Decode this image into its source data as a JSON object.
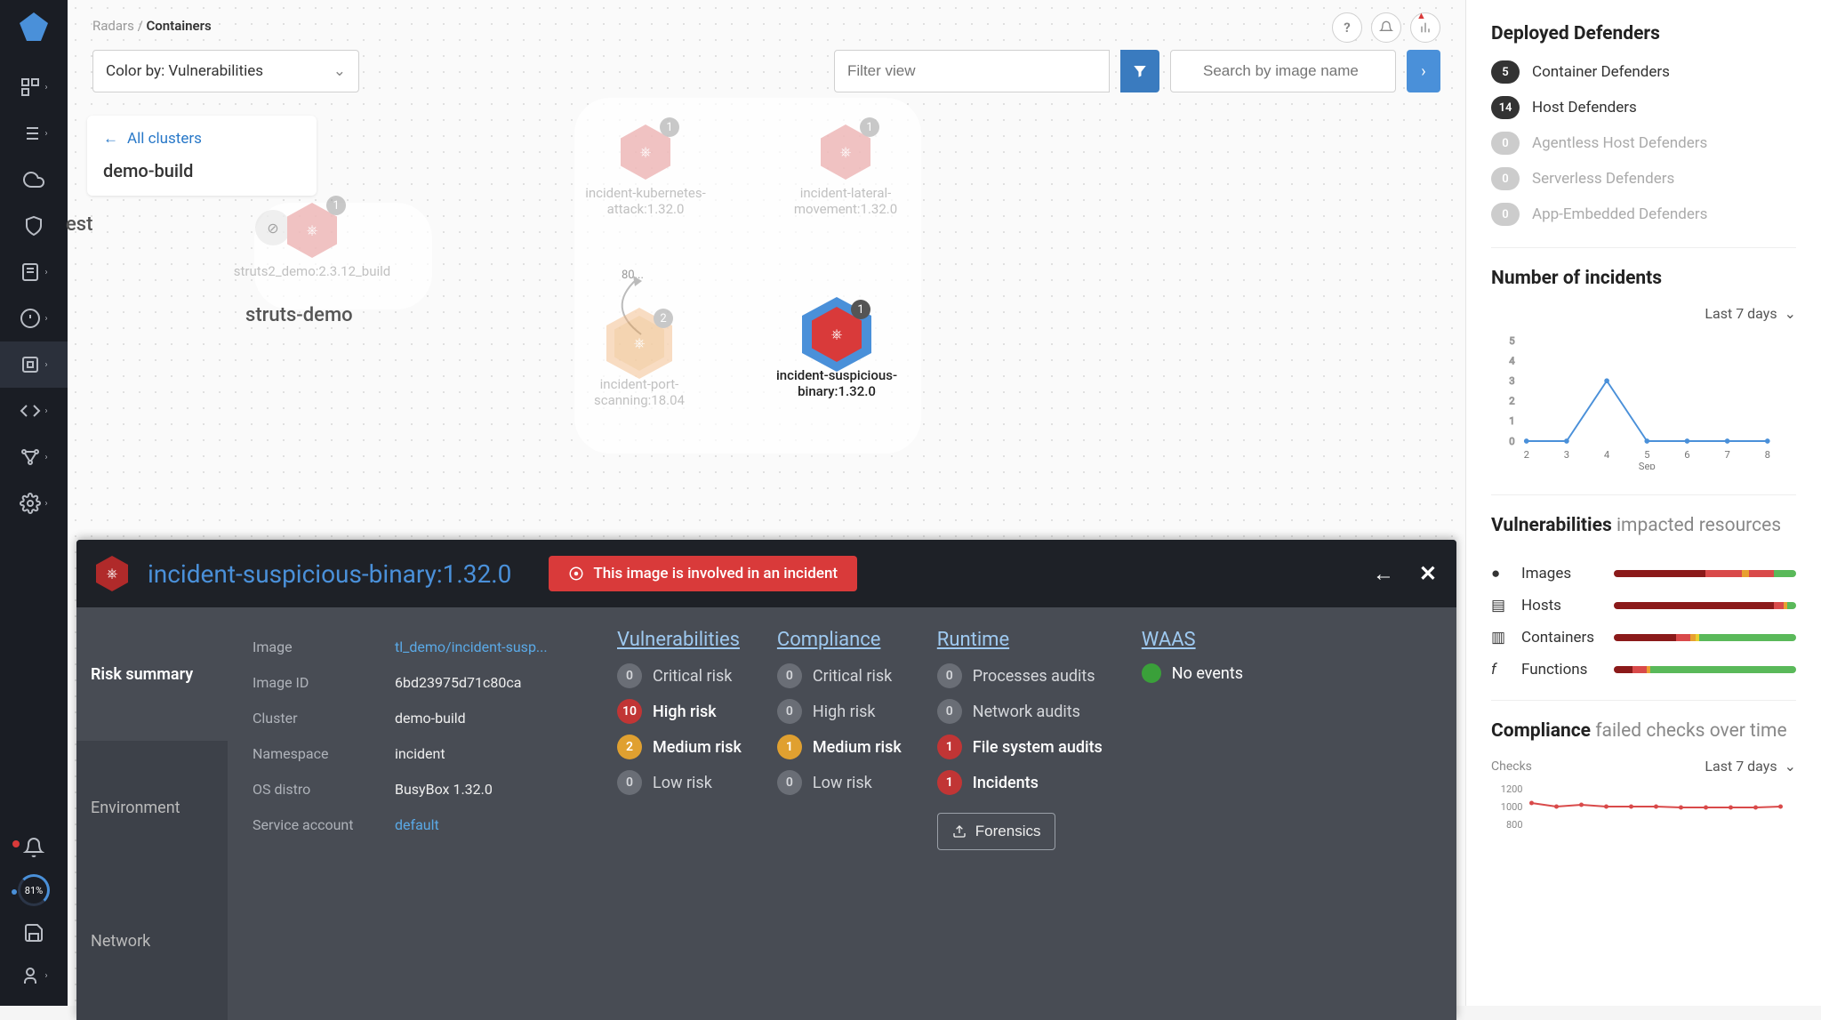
{
  "breadcrumb": {
    "root": "Radars",
    "sep": " / ",
    "current": "Containers"
  },
  "toolbar": {
    "color_by": "Color by: Vulnerabilities",
    "filter_placeholder": "Filter view",
    "search_placeholder": "Search by image name"
  },
  "cluster_card": {
    "back": "All clusters",
    "name": "demo-build"
  },
  "canvas": {
    "section_labels": {
      "test": "est",
      "struts": "struts-demo"
    },
    "port_label": "80...",
    "nodes": {
      "struts2": {
        "label": "struts2_demo:2.3.12_build",
        "badge": "1"
      },
      "k8s_attack": {
        "label": "incident-kubernetes-attack:1.32.0",
        "badge": "1"
      },
      "lateral": {
        "label": "incident-lateral-movement:1.32.0",
        "badge": "1"
      },
      "port_scan": {
        "label": "incident-port-scanning:18.04",
        "badge": "2"
      },
      "suspicious": {
        "label": "incident-suspicious-binary:1.32.0",
        "badge": "1"
      }
    }
  },
  "detail": {
    "title": "incident-suspicious-binary:1.32.0",
    "banner": "This image is involved in an incident",
    "tabs": {
      "risk": "Risk summary",
      "env": "Environment",
      "net": "Network"
    },
    "meta": {
      "image_k": "Image",
      "image_v": "tl_demo/incident-susp...",
      "image_id_k": "Image ID",
      "image_id_v": "6bd23975d71c80ca",
      "cluster_k": "Cluster",
      "cluster_v": "demo-build",
      "ns_k": "Namespace",
      "ns_v": "incident",
      "os_k": "OS distro",
      "os_v": "BusyBox 1.32.0",
      "sa_k": "Service account",
      "sa_v": "default"
    },
    "vuln": {
      "head": "Vulnerabilities",
      "critical_n": "0",
      "critical_l": "Critical risk",
      "high_n": "10",
      "high_l": "High risk",
      "med_n": "2",
      "med_l": "Medium risk",
      "low_n": "0",
      "low_l": "Low risk"
    },
    "comp": {
      "head": "Compliance",
      "critical_n": "0",
      "critical_l": "Critical risk",
      "high_n": "0",
      "high_l": "High risk",
      "med_n": "1",
      "med_l": "Medium risk",
      "low_n": "0",
      "low_l": "Low risk"
    },
    "runtime": {
      "head": "Runtime",
      "proc_n": "0",
      "proc_l": "Processes audits",
      "net_n": "0",
      "net_l": "Network audits",
      "fs_n": "1",
      "fs_l": "File system audits",
      "inc_n": "1",
      "inc_l": "Incidents",
      "forensics": "Forensics"
    },
    "waas": {
      "head": "WAAS",
      "label": "No events"
    }
  },
  "right": {
    "deployed_h": "Deployed Defenders",
    "defenders": [
      {
        "n": "5",
        "label": "Container Defenders",
        "muted": false
      },
      {
        "n": "14",
        "label": "Host Defenders",
        "muted": false
      },
      {
        "n": "0",
        "label": "Agentless Host Defenders",
        "muted": true
      },
      {
        "n": "0",
        "label": "Serverless Defenders",
        "muted": true
      },
      {
        "n": "0",
        "label": "App-Embedded Defenders",
        "muted": true
      }
    ],
    "incidents_h": "Number of incidents",
    "period": "Last 7 days",
    "vuln_h_strong": "Vulnerabilities",
    "vuln_h_rest": " impacted resources",
    "resources": {
      "images": "Images",
      "hosts": "Hosts",
      "containers": "Containers",
      "functions": "Functions"
    },
    "comp_h_strong": "Compliance",
    "comp_h_rest": " failed checks over time",
    "checks_label": "Checks"
  },
  "gauge": "81%",
  "chart_data": [
    {
      "type": "line",
      "title": "Number of incidents",
      "x_domain": [
        2,
        8
      ],
      "xticks": [
        2,
        3,
        4,
        5,
        6,
        7,
        8
      ],
      "xlabel": "Sep",
      "ylabel": "",
      "ylim": [
        0,
        5
      ],
      "yticks": [
        0,
        1,
        2,
        3,
        4,
        5
      ],
      "series": [
        {
          "name": "incidents",
          "x": [
            2,
            3,
            4,
            5,
            6,
            7,
            8
          ],
          "y": [
            0,
            0,
            3,
            0,
            0,
            0,
            0
          ]
        }
      ]
    },
    {
      "type": "bar",
      "title": "Vulnerabilities impacted resources",
      "note": "segmented severity bars per resource; values are approximate share (%)",
      "categories": [
        "Images",
        "Hosts",
        "Containers",
        "Functions"
      ],
      "series": [
        {
          "name": "critical",
          "values": [
            50,
            88,
            34,
            10
          ]
        },
        {
          "name": "high",
          "values": [
            20,
            5,
            8,
            8
          ]
        },
        {
          "name": "medium",
          "values": [
            8,
            2,
            5,
            2
          ]
        },
        {
          "name": "low",
          "values": [
            22,
            5,
            53,
            80
          ]
        }
      ]
    },
    {
      "type": "line",
      "title": "Compliance failed checks over time",
      "xlabel": "",
      "ylabel": "Checks",
      "ylim": [
        800,
        1200
      ],
      "yticks": [
        800,
        1000,
        1200
      ],
      "series": [
        {
          "name": "checks",
          "x": [
            1,
            2,
            3,
            4,
            5,
            6,
            7,
            8,
            9,
            10,
            11
          ],
          "y": [
            1080,
            1050,
            1060,
            1050,
            1050,
            1050,
            1040,
            1040,
            1040,
            1040,
            1050
          ]
        }
      ]
    }
  ]
}
